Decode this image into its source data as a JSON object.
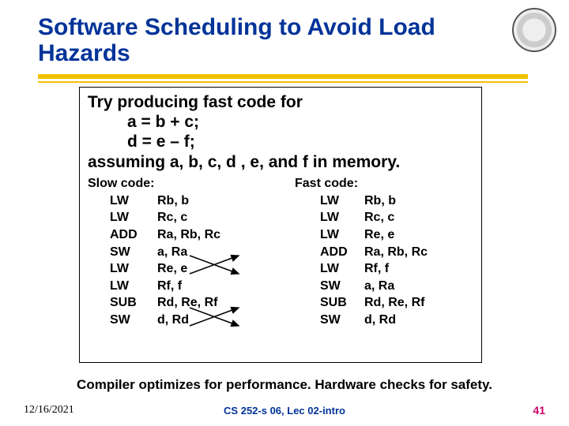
{
  "title": "Software Scheduling to Avoid Load Hazards",
  "intro": {
    "line1": "Try producing fast code for",
    "expr1": "a = b + c;",
    "expr2": "d = e – f;",
    "line2": "assuming a, b, c, d , e, and f in memory."
  },
  "slow": {
    "title": "Slow code:",
    "rows": [
      {
        "op": "LW",
        "args": "Rb, b"
      },
      {
        "op": "LW",
        "args": "Rc, c"
      },
      {
        "op": "ADD",
        "args": "Ra, Rb, Rc"
      },
      {
        "op": "SW",
        "args": "a, Ra"
      },
      {
        "op": "LW",
        "args": "Re, e"
      },
      {
        "op": "LW",
        "args": "Rf, f"
      },
      {
        "op": "SUB",
        "args": "Rd, Re, Rf"
      },
      {
        "op": "SW",
        "args": "d, Rd"
      }
    ]
  },
  "fast": {
    "title": "Fast code:",
    "rows": [
      {
        "op": "LW",
        "args": "Rb, b"
      },
      {
        "op": "LW",
        "args": "Rc, c"
      },
      {
        "op": "LW",
        "args": "Re, e"
      },
      {
        "op": "ADD",
        "args": "Ra, Rb, Rc"
      },
      {
        "op": "LW",
        "args": "Rf, f"
      },
      {
        "op": "SW",
        "args": "a, Ra"
      },
      {
        "op": "SUB",
        "args": "Rd, Re, Rf"
      },
      {
        "op": "SW",
        "args": "d, Rd"
      }
    ]
  },
  "bottom_note": "Compiler optimizes for performance.  Hardware checks for safety.",
  "footer": {
    "date": "12/16/2021",
    "mid": "CS 252-s 06, Lec 02-intro",
    "page": "41"
  }
}
